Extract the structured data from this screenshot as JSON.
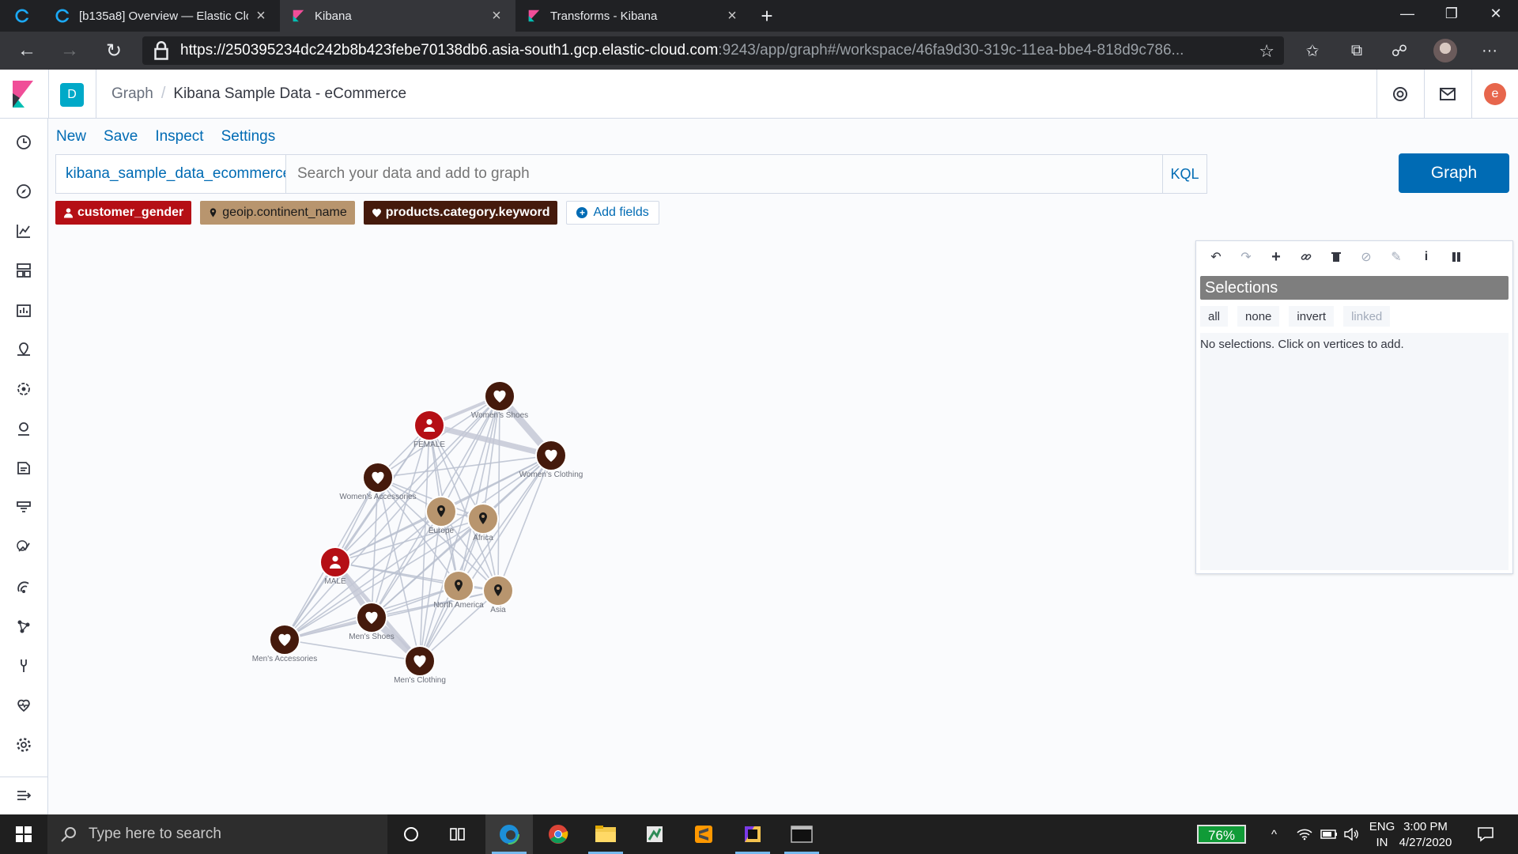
{
  "browser": {
    "tabs": [
      {
        "title": "[b135a8] Overview — Elastic Clo",
        "active": false
      },
      {
        "title": "Kibana",
        "active": true
      },
      {
        "title": "Transforms - Kibana",
        "active": false
      }
    ],
    "url_host": "https://250395234dc242b8b423febe70138db6.asia-south1.gcp.elastic-cloud.com",
    "url_path": ":9243/app/graph#/workspace/46fa9d30-319c-11ea-bbe4-818d9c786..."
  },
  "header": {
    "space_initial": "D",
    "breadcrumb_app": "Graph",
    "breadcrumb_page": "Kibana Sample Data - eCommerce",
    "user_initial": "e"
  },
  "menu": {
    "new": "New",
    "save": "Save",
    "inspect": "Inspect",
    "settings": "Settings"
  },
  "search": {
    "index": "kibana_sample_data_ecommerce",
    "placeholder": "Search your data and add to graph",
    "language": "KQL",
    "submit": "Graph"
  },
  "fields": [
    {
      "label": "customer_gender",
      "icon": "user-icon",
      "color": "#b50f15"
    },
    {
      "label": "geoip.continent_name",
      "icon": "map-marker-icon",
      "color": "#b8956e"
    },
    {
      "label": "products.category.keyword",
      "icon": "heart-icon",
      "color": "#451a0c"
    }
  ],
  "add_fields": "Add fields",
  "graph": {
    "vertices": [
      {
        "label": "Women's Shoes",
        "type": "heart",
        "color": "#451a0c"
      },
      {
        "label": "FEMALE",
        "type": "user",
        "color": "#b50f15"
      },
      {
        "label": "Women's Clothing",
        "type": "heart",
        "color": "#451a0c"
      },
      {
        "label": "Women's Accessories",
        "type": "heart",
        "color": "#451a0c"
      },
      {
        "label": "Europe",
        "type": "pin",
        "color": "#b8956e"
      },
      {
        "label": "Africa",
        "type": "pin",
        "color": "#b8956e"
      },
      {
        "label": "MALE",
        "type": "user",
        "color": "#b50f15"
      },
      {
        "label": "North America",
        "type": "pin",
        "color": "#b8956e"
      },
      {
        "label": "Asia",
        "type": "pin",
        "color": "#b8956e"
      },
      {
        "label": "Men's Shoes",
        "type": "heart",
        "color": "#451a0c"
      },
      {
        "label": "Men's Accessories",
        "type": "heart",
        "color": "#451a0c"
      },
      {
        "label": "Men's Clothing",
        "type": "heart",
        "color": "#451a0c"
      }
    ]
  },
  "panel": {
    "tools": [
      "undo-icon",
      "redo-icon",
      "expand-icon",
      "link-icon",
      "delete-icon",
      "block-icon",
      "style-icon",
      "info-icon",
      "pause-icon"
    ],
    "title": "Selections",
    "buttons": {
      "all": "all",
      "none": "none",
      "invert": "invert",
      "linked": "linked"
    },
    "empty_message": "No selections. Click on vertices to add."
  },
  "taskbar": {
    "search_placeholder": "Type here to search",
    "battery": "76%",
    "lang_top": "ENG",
    "lang_bottom": "IN",
    "time": "3:00 PM",
    "date": "4/27/2020"
  }
}
